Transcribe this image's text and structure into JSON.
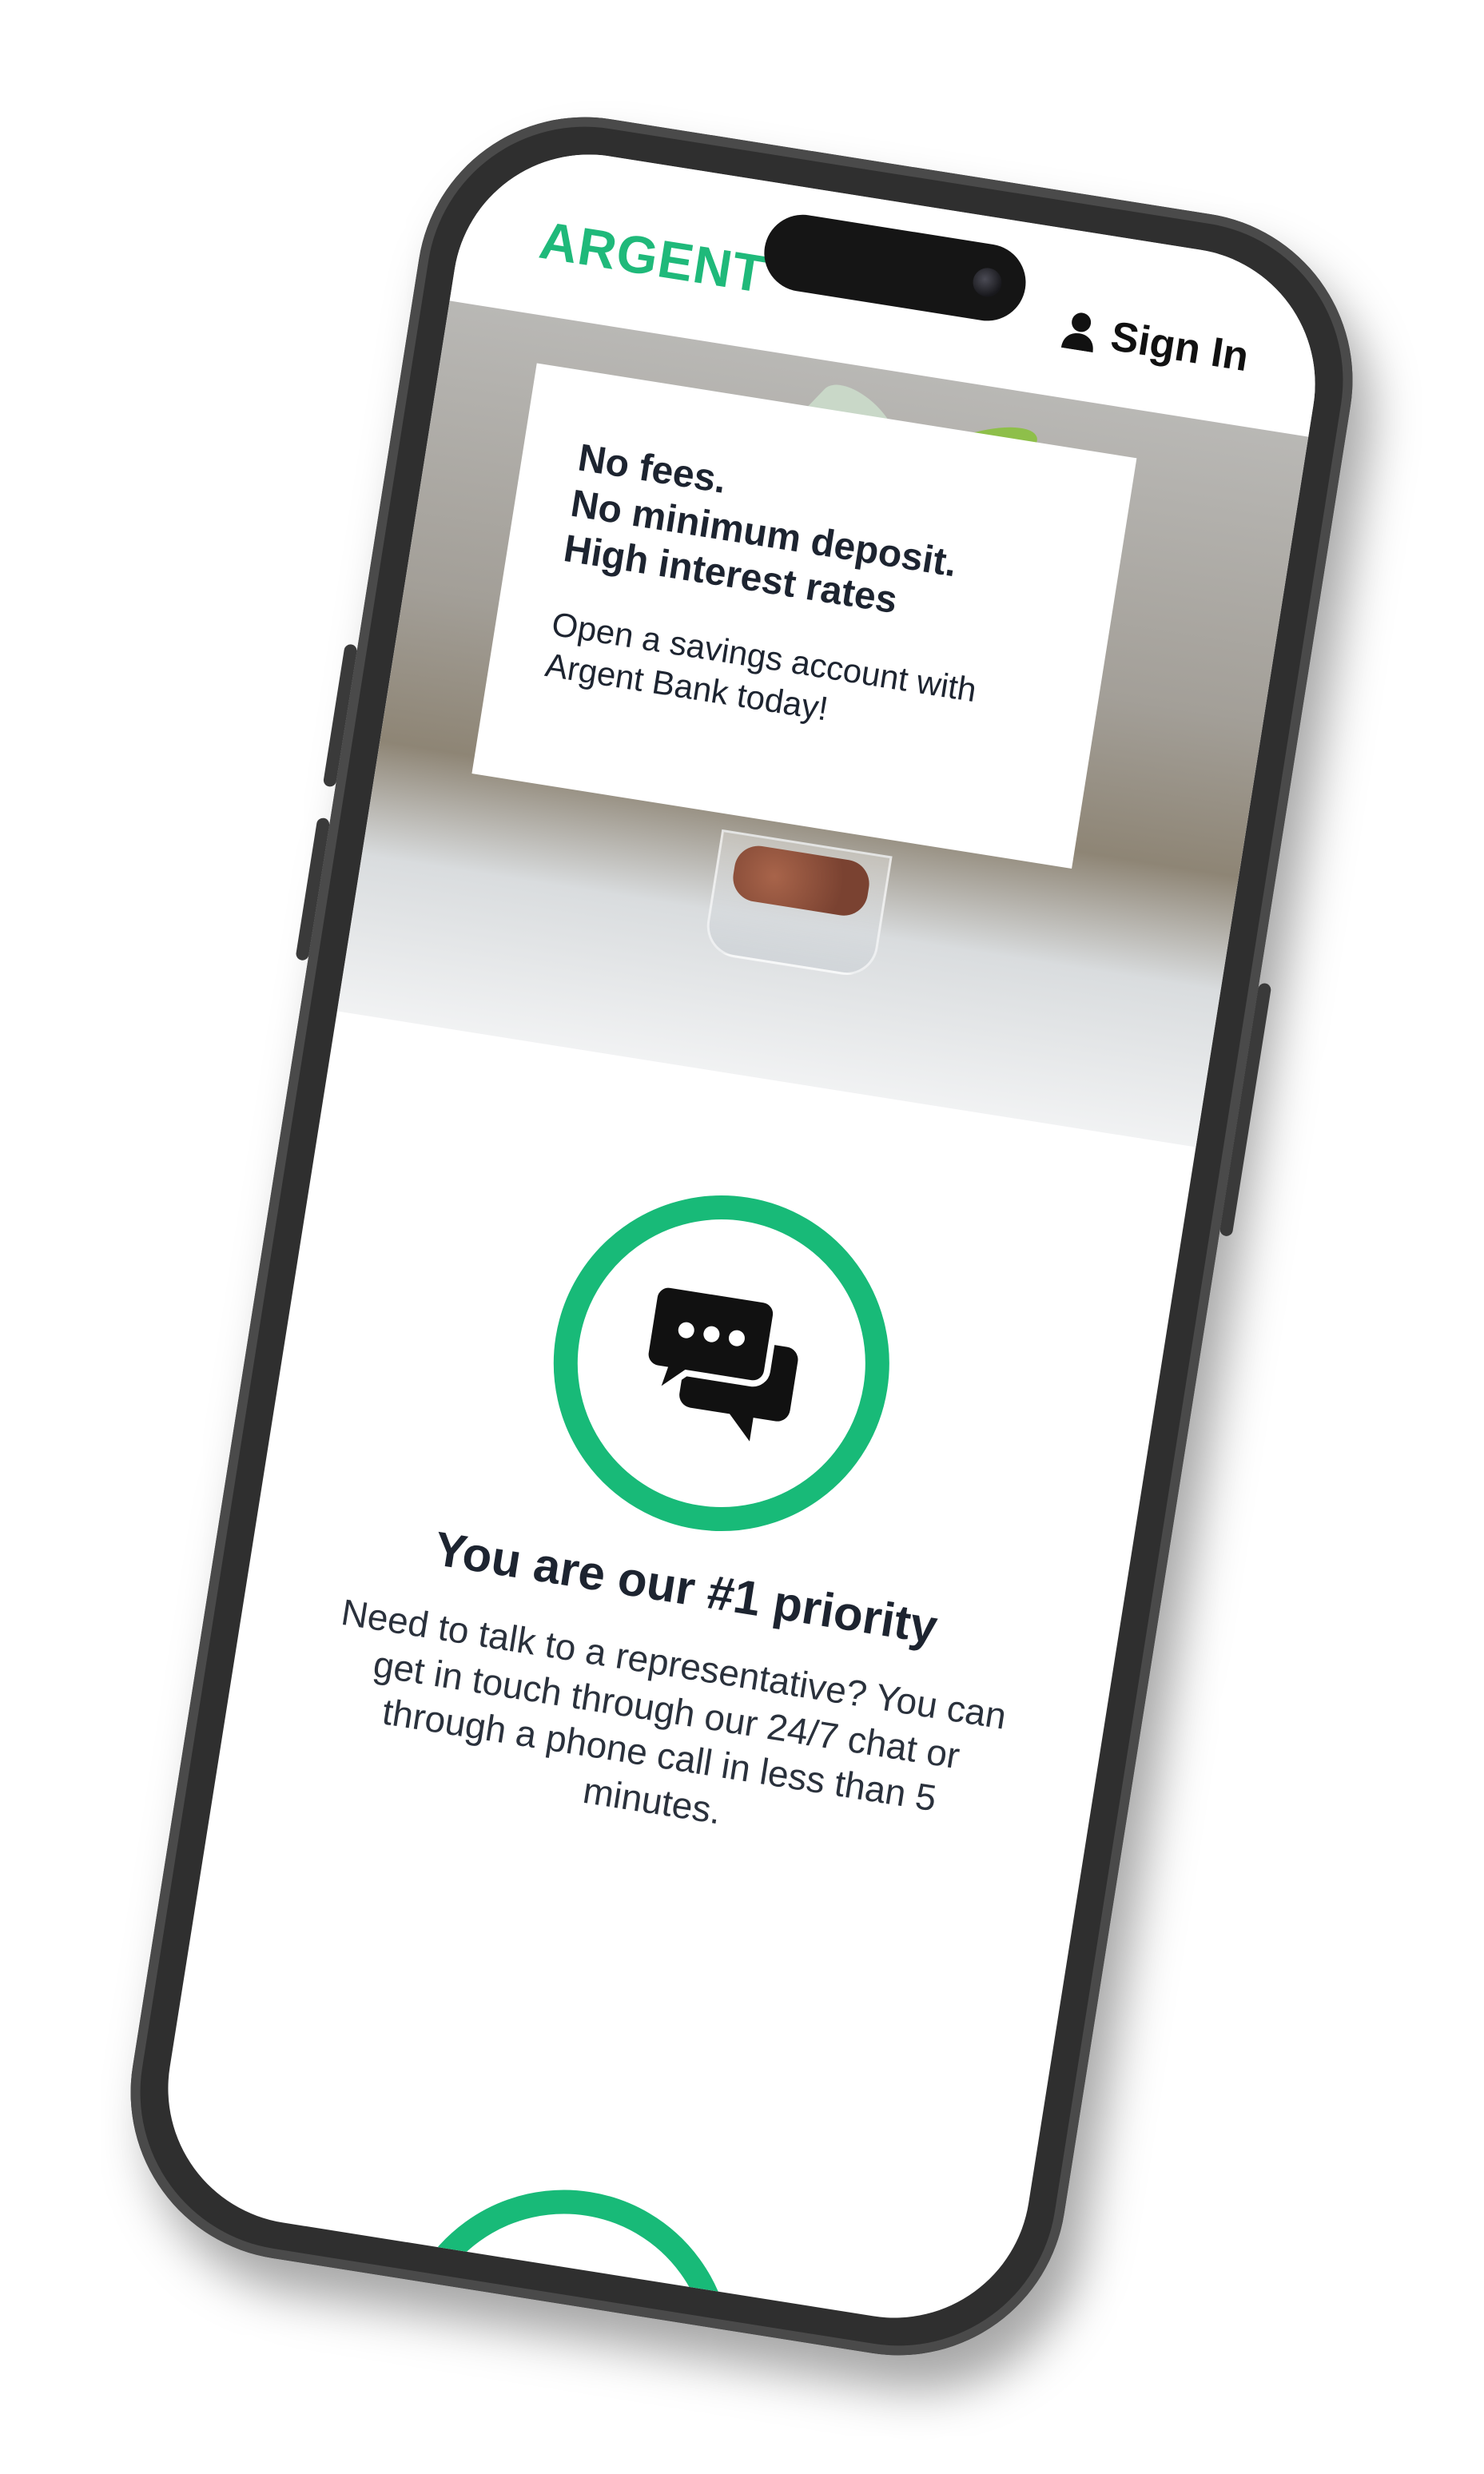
{
  "header": {
    "logo_text": "ARGENT",
    "signin_label": "Sign In"
  },
  "promo": {
    "headline_lines": [
      "No fees.",
      "No minimum deposit.",
      "High interest rates"
    ],
    "subtext": "Open a savings account with Argent Bank today!"
  },
  "support": {
    "title": "You are our #1 priority",
    "text": "Need to talk to a representative? You can get in touch through our 24/7 chat or through a phone call in less than 5 minutes."
  },
  "colors": {
    "brand_green": "#1fb97a",
    "text_dark": "#1d2430"
  },
  "icons": {
    "signin_icon": "user-icon",
    "support_icon": "chat-bubbles-icon"
  }
}
